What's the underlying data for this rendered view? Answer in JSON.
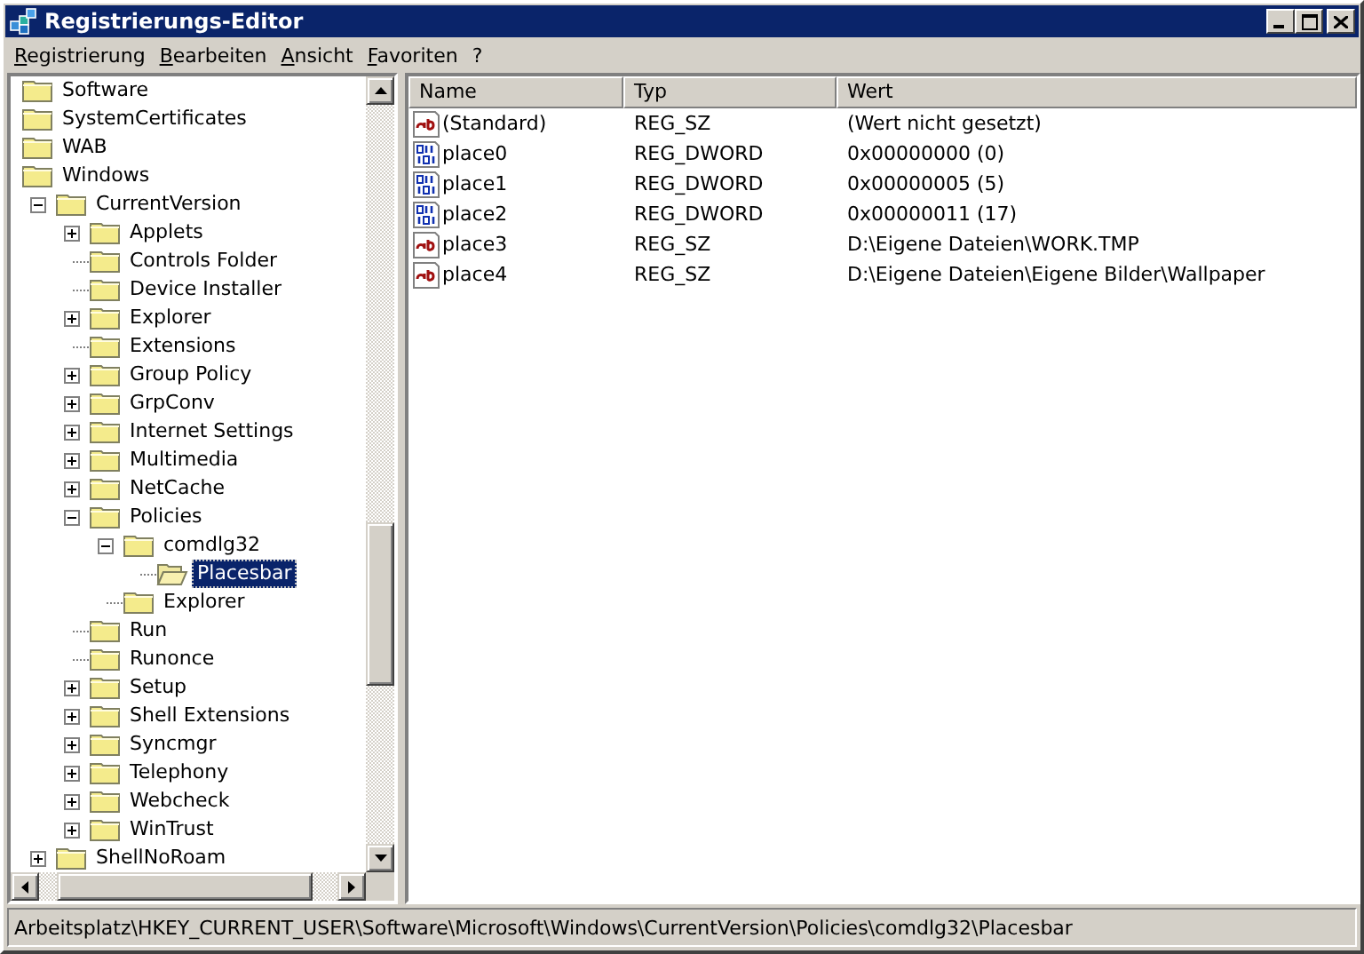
{
  "window": {
    "title": "Registrierungs-Editor"
  },
  "menu": [
    "Registrierung",
    "Bearbeiten",
    "Ansicht",
    "Favoriten",
    "?"
  ],
  "tree": [
    {
      "label": "Software",
      "selected": false
    },
    {
      "label": "SystemCertificates",
      "selected": false
    },
    {
      "label": "WAB",
      "selected": false
    },
    {
      "label": "Windows",
      "selected": false,
      "children": [
        {
          "label": "CurrentVersion",
          "kind": "expanded",
          "selected": false,
          "children": [
            {
              "label": "Applets",
              "kind": "collapsed",
              "selected": false
            },
            {
              "label": "Controls Folder",
              "kind": "leaf",
              "selected": false
            },
            {
              "label": "Device Installer",
              "kind": "leaf",
              "selected": false
            },
            {
              "label": "Explorer",
              "kind": "collapsed",
              "selected": false
            },
            {
              "label": "Extensions",
              "kind": "leaf",
              "selected": false
            },
            {
              "label": "Group Policy",
              "kind": "collapsed",
              "selected": false
            },
            {
              "label": "GrpConv",
              "kind": "collapsed",
              "selected": false
            },
            {
              "label": "Internet Settings",
              "kind": "collapsed",
              "selected": false
            },
            {
              "label": "Multimedia",
              "kind": "collapsed",
              "selected": false
            },
            {
              "label": "NetCache",
              "kind": "collapsed",
              "selected": false
            },
            {
              "label": "Policies",
              "kind": "expanded",
              "selected": false,
              "children": [
                {
                  "label": "comdlg32",
                  "kind": "expanded",
                  "selected": false,
                  "children": [
                    {
                      "label": "Placesbar",
                      "kind": "leaf",
                      "selected": true
                    }
                  ]
                },
                {
                  "label": "Explorer",
                  "kind": "leaf",
                  "selected": false
                }
              ]
            },
            {
              "label": "Run",
              "kind": "leaf",
              "selected": false
            },
            {
              "label": "Runonce",
              "kind": "leaf",
              "selected": false
            },
            {
              "label": "Setup",
              "kind": "collapsed",
              "selected": false
            },
            {
              "label": "Shell Extensions",
              "kind": "collapsed",
              "selected": false
            },
            {
              "label": "Syncmgr",
              "kind": "collapsed",
              "selected": false
            },
            {
              "label": "Telephony",
              "kind": "collapsed",
              "selected": false
            },
            {
              "label": "Webcheck",
              "kind": "collapsed",
              "selected": false
            },
            {
              "label": "WinTrust",
              "kind": "collapsed",
              "selected": false
            }
          ]
        },
        {
          "label": "ShellNoRoam",
          "kind": "collapsed",
          "selected": false
        }
      ]
    }
  ],
  "list": {
    "columns": [
      "Name",
      "Typ",
      "Wert"
    ],
    "rows": [
      {
        "kind": "string",
        "name": "(Standard)",
        "type": "REG_SZ",
        "value": "(Wert nicht gesetzt)"
      },
      {
        "kind": "dword",
        "name": "place0",
        "type": "REG_DWORD",
        "value": "0x00000000 (0)"
      },
      {
        "kind": "dword",
        "name": "place1",
        "type": "REG_DWORD",
        "value": "0x00000005 (5)"
      },
      {
        "kind": "dword",
        "name": "place2",
        "type": "REG_DWORD",
        "value": "0x00000011 (17)"
      },
      {
        "kind": "string",
        "name": "place3",
        "type": "REG_SZ",
        "value": "D:\\Eigene Dateien\\WORK.TMP"
      },
      {
        "kind": "string",
        "name": "place4",
        "type": "REG_SZ",
        "value": "D:\\Eigene Dateien\\Eigene Bilder\\Wallpaper"
      }
    ]
  },
  "status_bar": "Arbeitsplatz\\HKEY_CURRENT_USER\\Software\\Microsoft\\Windows\\CurrentVersion\\Policies\\comdlg32\\Placesbar"
}
